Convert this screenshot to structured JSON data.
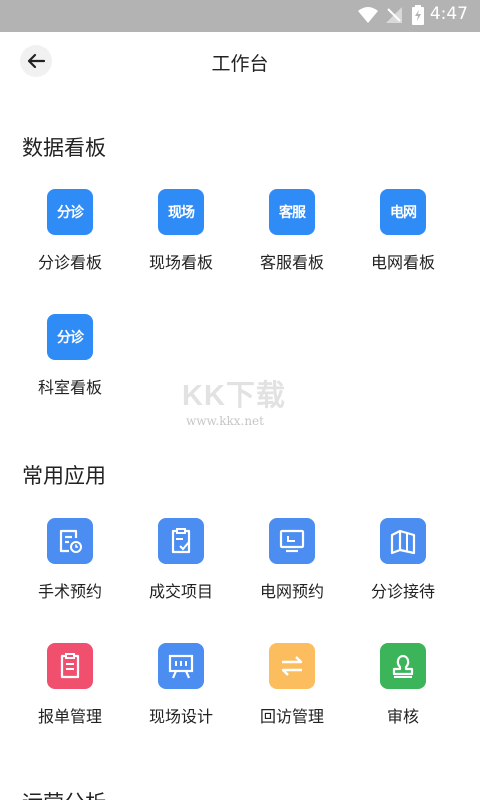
{
  "status_bar": {
    "time": "4:47"
  },
  "header": {
    "title": "工作台"
  },
  "sections": {
    "data_board": {
      "title": "数据看板",
      "items": [
        {
          "tile_text": "分诊",
          "label": "分诊看板"
        },
        {
          "tile_text": "现场",
          "label": "现场看板"
        },
        {
          "tile_text": "客服",
          "label": "客服看板"
        },
        {
          "tile_text": "电网",
          "label": "电网看板"
        },
        {
          "tile_text": "分诊",
          "label": "科室看板"
        }
      ]
    },
    "common_apps": {
      "title": "常用应用",
      "items": [
        {
          "icon": "document-clock-icon",
          "label": "手术预约"
        },
        {
          "icon": "clipboard-check-icon",
          "label": "成交项目"
        },
        {
          "icon": "monitor-icon",
          "label": "电网预约"
        },
        {
          "icon": "map-icon",
          "label": "分诊接待"
        },
        {
          "icon": "clipboard-list-icon",
          "label": "报单管理"
        },
        {
          "icon": "easel-icon",
          "label": "现场设计"
        },
        {
          "icon": "swap-arrows-icon",
          "label": "回访管理"
        },
        {
          "icon": "stamp-icon",
          "label": "审核"
        }
      ]
    },
    "operations": {
      "title": "运营分析"
    }
  },
  "watermark": {
    "main": "KK下载",
    "sub": "www.kkx.net"
  },
  "colors": {
    "tile_blue": "#2f8cf6",
    "app_blue": "#4b8df0",
    "app_red": "#f0506e",
    "app_orange": "#fbbd5e",
    "app_green": "#3bb45a",
    "status_bar": "#b3b3b3"
  }
}
